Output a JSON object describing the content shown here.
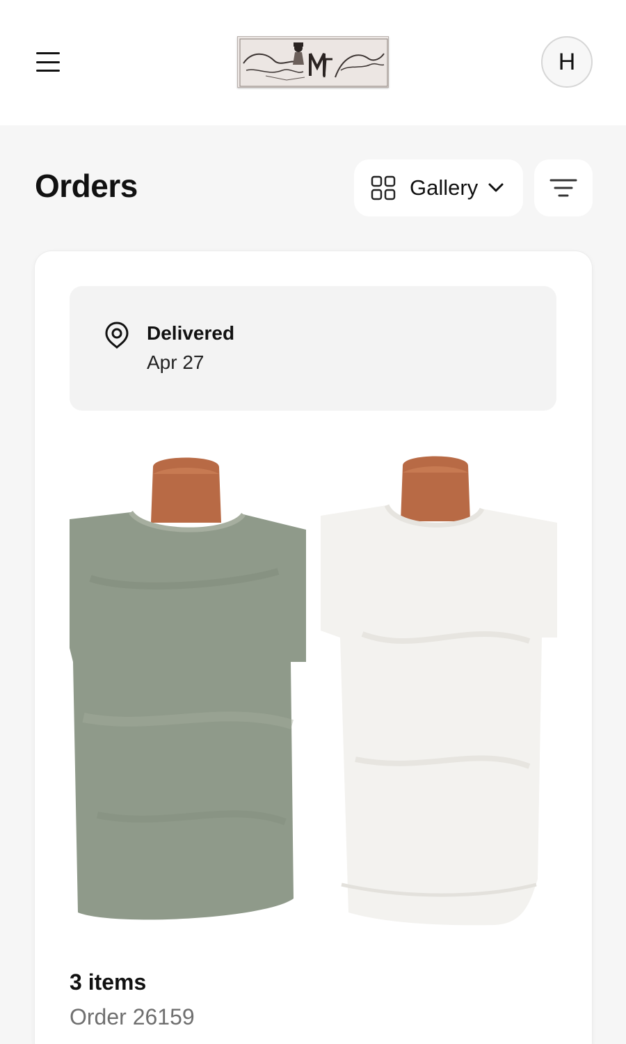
{
  "header": {
    "logo_text": "Mr Freedom · mister Freedom",
    "avatar_initial": "H"
  },
  "page": {
    "title": "Orders"
  },
  "view_select": {
    "label": "Gallery"
  },
  "order": {
    "status": "Delivered",
    "date": "Apr 27",
    "items_count": "3 items",
    "order_number": "Order 26159",
    "products": [
      {
        "name": "heather green t-shirt",
        "color": "#8f9a8a"
      },
      {
        "name": "white t-shirt",
        "color": "#f3f2ef"
      }
    ]
  },
  "colors": {
    "background": "#f6f6f6",
    "card": "#ffffff",
    "status_box": "#f3f3f3",
    "muted_text": "#6f6f6f"
  }
}
